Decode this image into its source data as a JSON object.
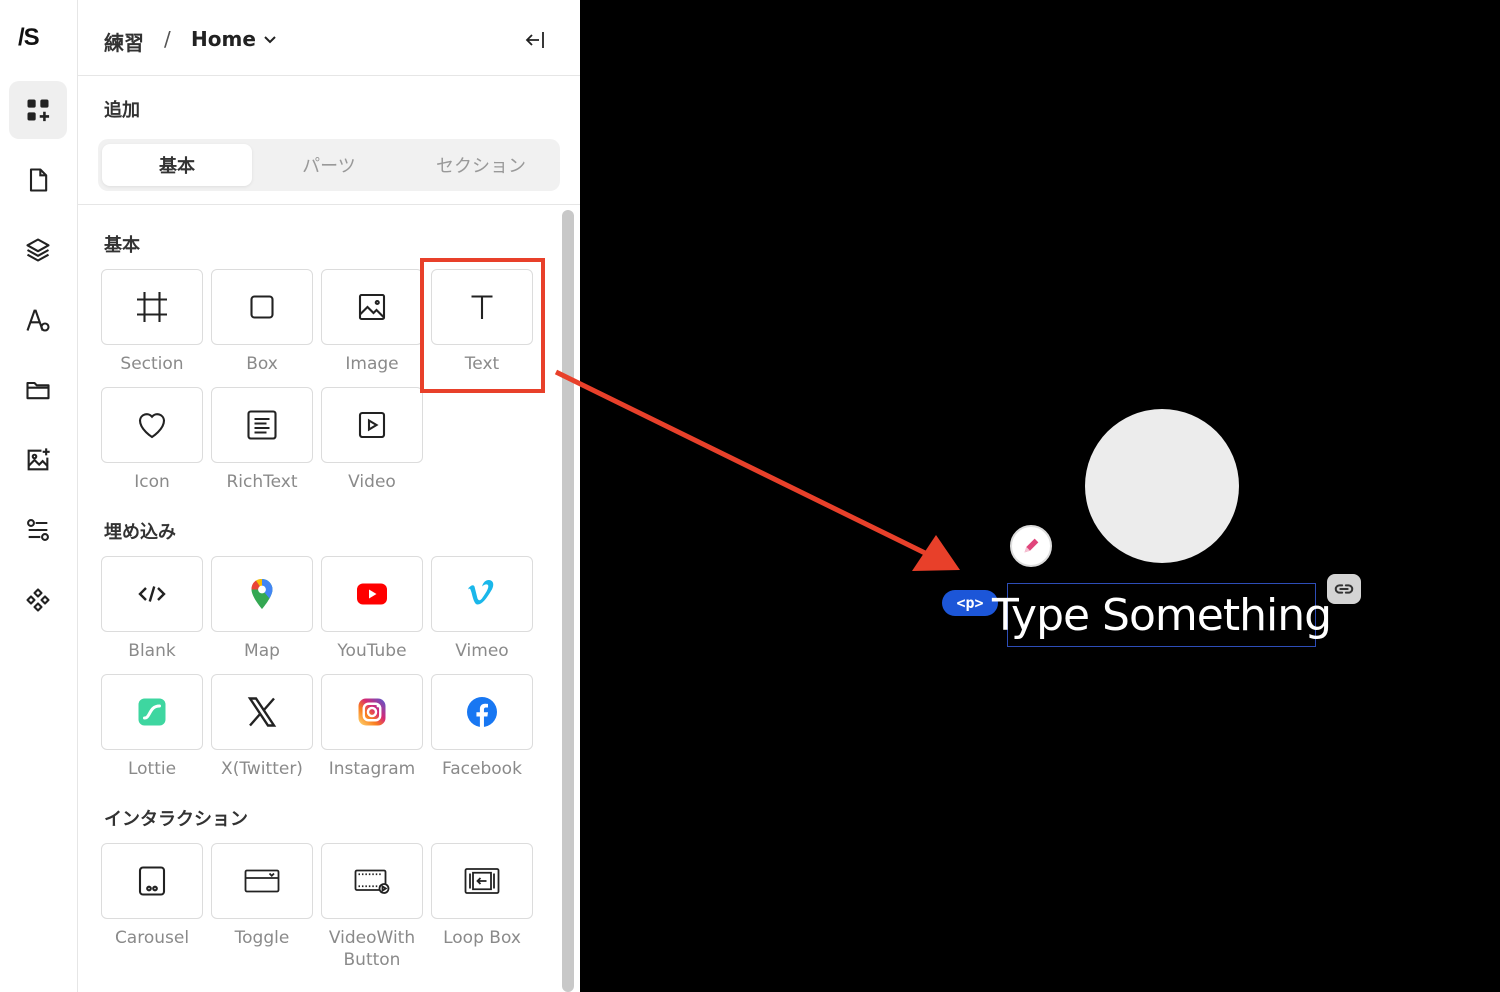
{
  "app": {
    "logo": "/S",
    "accent": "#e8402a",
    "selection_color": "#1c56d8"
  },
  "rail": {
    "items": [
      {
        "icon": "add-element-icon",
        "active": true
      },
      {
        "icon": "page-icon",
        "active": false
      },
      {
        "icon": "layers-icon",
        "active": false
      },
      {
        "icon": "typography-icon",
        "active": false
      },
      {
        "icon": "folder-icon",
        "active": false
      },
      {
        "icon": "add-image-icon",
        "active": false
      },
      {
        "icon": "interaction-flow-icon",
        "active": false
      },
      {
        "icon": "components-icon",
        "active": false
      }
    ]
  },
  "breadcrumb": {
    "project": "練習",
    "separator": "/",
    "page": "Home"
  },
  "panel": {
    "title": "追加",
    "tabs": [
      "基本",
      "パーツ",
      "セクション"
    ],
    "active_tab": "基本",
    "sections": [
      {
        "title": "基本",
        "items": [
          {
            "label": "Section",
            "icon": "section-icon"
          },
          {
            "label": "Box",
            "icon": "box-icon"
          },
          {
            "label": "Image",
            "icon": "image-icon"
          },
          {
            "label": "Text",
            "icon": "text-icon",
            "highlighted": true
          },
          {
            "label": "Icon",
            "icon": "heart-icon"
          },
          {
            "label": "RichText",
            "icon": "richtext-icon"
          },
          {
            "label": "Video",
            "icon": "video-icon"
          }
        ]
      },
      {
        "title": "埋め込み",
        "items": [
          {
            "label": "Blank",
            "icon": "code-icon"
          },
          {
            "label": "Map",
            "icon": "map-pin-icon"
          },
          {
            "label": "YouTube",
            "icon": "youtube-icon"
          },
          {
            "label": "Vimeo",
            "icon": "vimeo-icon"
          },
          {
            "label": "Lottie",
            "icon": "lottie-icon"
          },
          {
            "label": "X(Twitter)",
            "icon": "x-icon"
          },
          {
            "label": "Instagram",
            "icon": "instagram-icon"
          },
          {
            "label": "Facebook",
            "icon": "facebook-icon"
          }
        ]
      },
      {
        "title": "インタラクション",
        "items": [
          {
            "label": "Carousel",
            "icon": "carousel-icon"
          },
          {
            "label": "Toggle",
            "icon": "toggle-icon"
          },
          {
            "label": "VideoWith\nButton",
            "icon": "video-with-button-icon"
          },
          {
            "label": "Loop Box",
            "icon": "loop-box-icon"
          }
        ]
      }
    ]
  },
  "canvas": {
    "tag": "<p>",
    "text": "Type Something"
  }
}
